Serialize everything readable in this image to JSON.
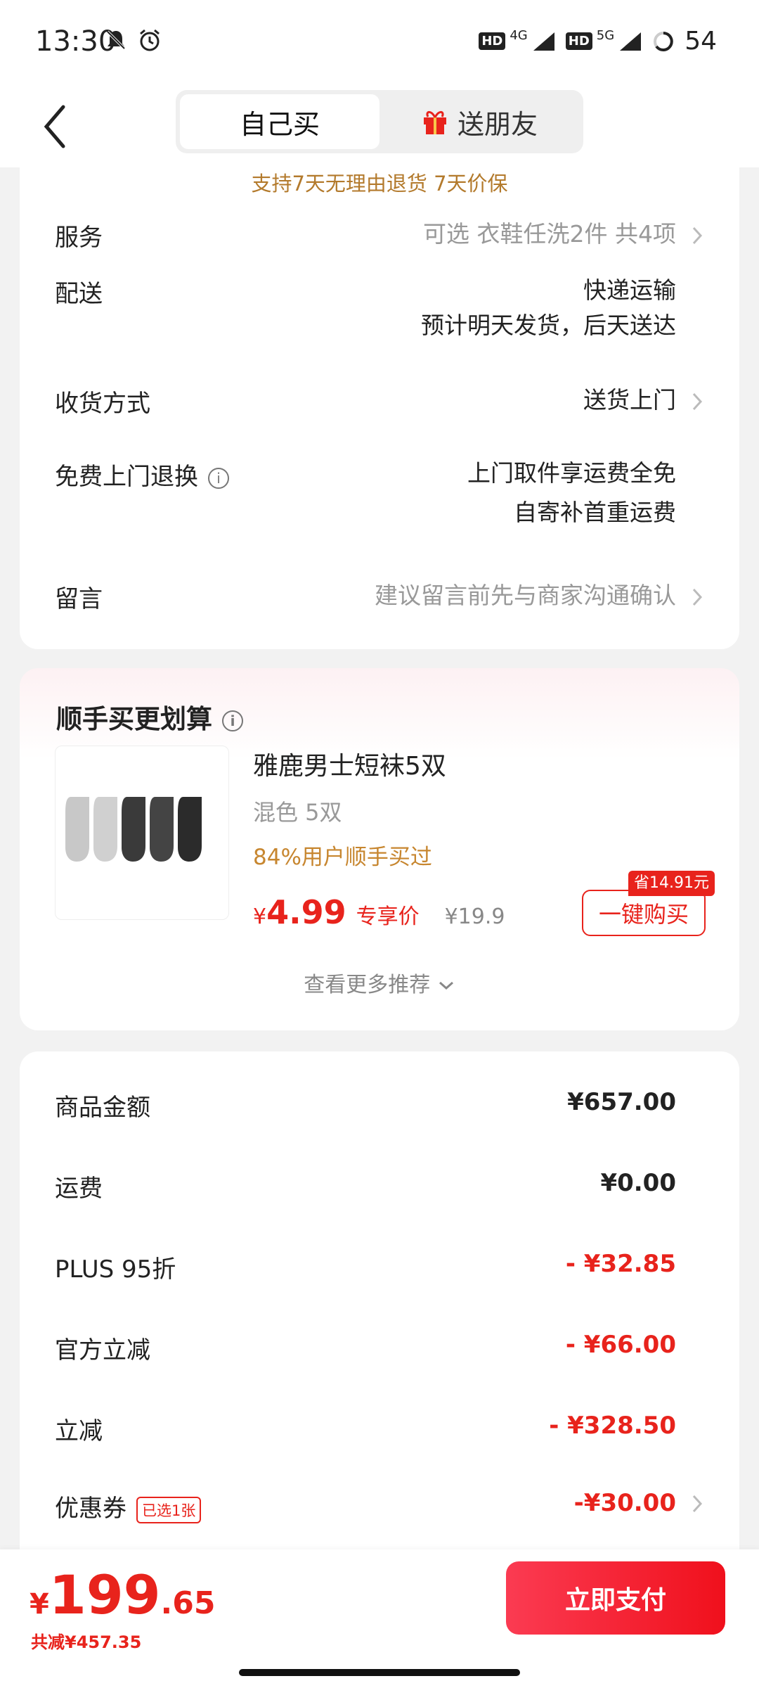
{
  "status_bar": {
    "time": "13:30",
    "net1_gen": "4G",
    "net2_gen": "5G",
    "hd": "HD",
    "battery": "54"
  },
  "header": {
    "tabs": [
      "自己买",
      "送朋友"
    ]
  },
  "order_info": {
    "guarantee": "支持7天无理由退货  7天价保",
    "service_label": "服务",
    "service_value": "可选 衣鞋任洗2件 共4项",
    "delivery_label": "配送",
    "delivery_line1": "快递运输",
    "delivery_line2": "预计明天发货，后天送达",
    "receive_label": "收货方式",
    "receive_value": "送货上门",
    "return_label": "免费上门退换",
    "return_line1": "上门取件享运费全免",
    "return_line2": "自寄补首重运费",
    "message_label": "留言",
    "message_placeholder": "建议留言前先与商家沟通确认"
  },
  "upsell": {
    "title": "顺手买更划算",
    "product_name": "雅鹿男士短袜5双",
    "variant": "混色 5双",
    "social_proof": "84%用户顺手买过",
    "currency": "¥",
    "price": "4.99",
    "price_tag": "专享价",
    "original_price": "¥19.9",
    "save_badge": "省14.91元",
    "buy_label": "一键购买",
    "more_label": "查看更多推荐"
  },
  "fees": [
    {
      "label": "商品金额",
      "value": "¥657.00",
      "red": false
    },
    {
      "label": "运费",
      "value": "¥0.00",
      "red": false
    },
    {
      "label": "PLUS 95折",
      "value": "- ¥32.85",
      "red": true
    },
    {
      "label": "官方立减",
      "value": "- ¥66.00",
      "red": true
    },
    {
      "label": "立减",
      "value": "- ¥328.50",
      "red": true
    },
    {
      "label": "优惠券",
      "value": "-¥30.00",
      "red": true
    }
  ],
  "coupon_badge": "已选1张",
  "footer": {
    "currency": "¥",
    "total_int": "199",
    "total_dec": ".65",
    "saved": "共减¥457.35",
    "pay_label": "立即支付"
  },
  "colors": {
    "accent_red": "#e8231c",
    "guarantee_gold": "#b37a2c"
  }
}
